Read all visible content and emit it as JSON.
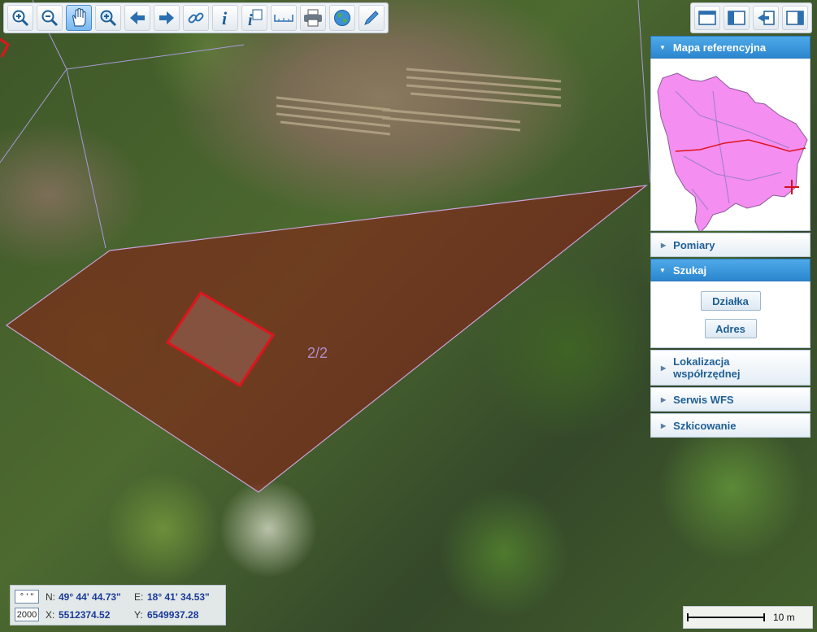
{
  "toolbar": {
    "tools": [
      {
        "name": "zoom-in",
        "icon": "zoom-in-icon"
      },
      {
        "name": "zoom-out",
        "icon": "zoom-out-icon"
      },
      {
        "name": "pan",
        "icon": "hand-icon",
        "active": true
      },
      {
        "name": "zoom-box",
        "icon": "magnifier-icon"
      },
      {
        "name": "back",
        "icon": "arrow-left-icon"
      },
      {
        "name": "forward",
        "icon": "arrow-right-icon"
      },
      {
        "name": "link",
        "icon": "link-icon"
      },
      {
        "name": "info",
        "icon": "info-icon"
      },
      {
        "name": "info-doc",
        "icon": "info-document-icon"
      },
      {
        "name": "measure",
        "icon": "ruler-icon"
      },
      {
        "name": "print",
        "icon": "printer-icon"
      },
      {
        "name": "globe",
        "icon": "globe-icon"
      },
      {
        "name": "draw",
        "icon": "pencil-icon"
      }
    ]
  },
  "window_tools": [
    "window-icon",
    "split-panel-icon",
    "export-icon",
    "right-panel-icon"
  ],
  "panel": {
    "reference_map": {
      "title": "Mapa referencyjna"
    },
    "measurements": {
      "title": "Pomiary"
    },
    "search": {
      "title": "Szukaj",
      "buttons": {
        "parcel": "Działka",
        "address": "Adres"
      }
    },
    "coordinate_location": {
      "line1": "Lokalizacja",
      "line2": "współrzędnej"
    },
    "wfs_service": {
      "title": "Serwis WFS"
    },
    "sketching": {
      "title": "Szkicowanie"
    }
  },
  "map": {
    "parcel_label": "2/2",
    "colors": {
      "parcel_fill": "#8b1a14",
      "parcel_outline": "#c9a3d8",
      "building_outline": "#e0141c",
      "reference_region": "#f48ef0",
      "reference_marker": "#d4101c"
    }
  },
  "coordinates": {
    "format_label": "° ' \"",
    "scale_value": "2000",
    "n_label": "N:",
    "n_value": "49° 44' 44.73\"",
    "e_label": "E:",
    "e_value": "18° 41' 34.53\"",
    "x_label": "X:",
    "x_value": "5512374.52",
    "y_label": "Y:",
    "y_value": "6549937.28"
  },
  "scale_bar": {
    "label": "10 m"
  },
  "accent": "#2b86cf"
}
